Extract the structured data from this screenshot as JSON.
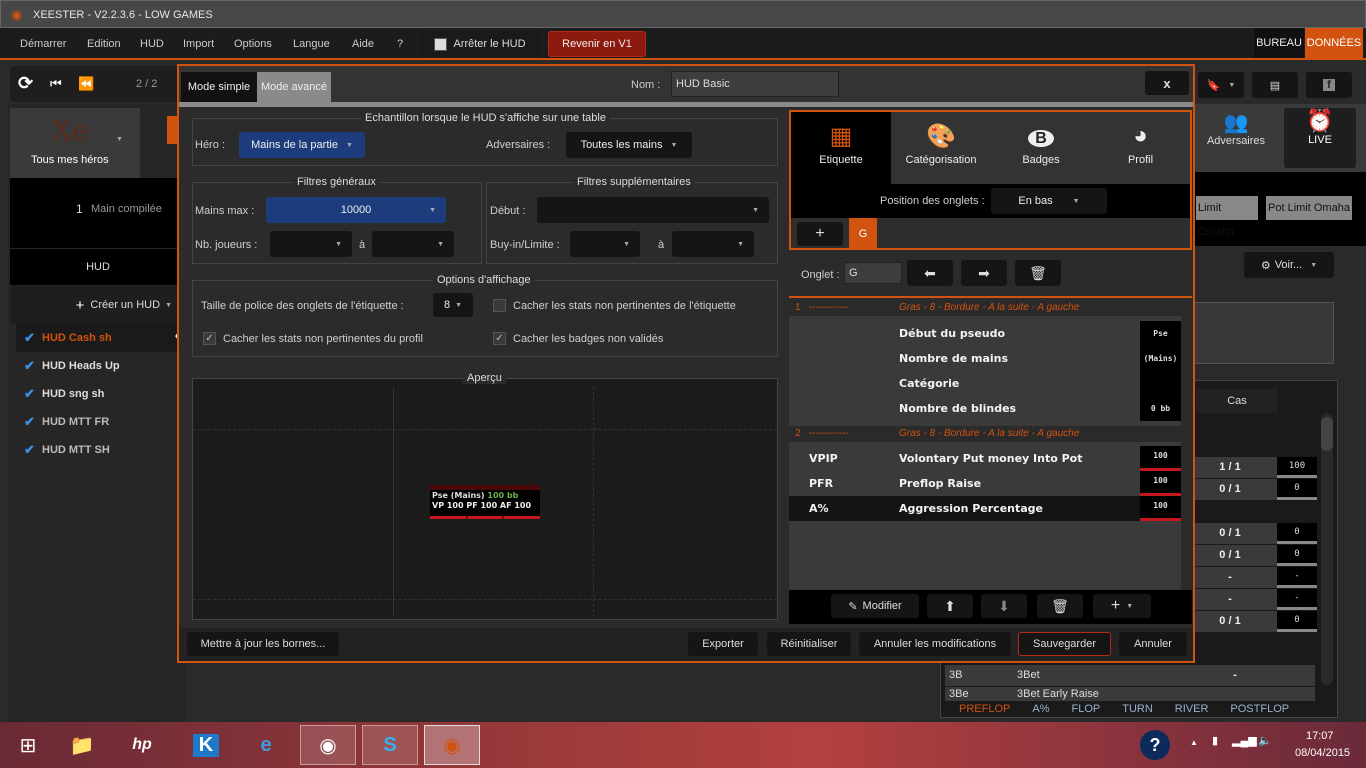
{
  "app": {
    "title": "XEESTER - V2.2.3.6 - LOW GAMES"
  },
  "menu": [
    "Démarrer",
    "Edition",
    "HUD",
    "Import",
    "Options",
    "Langue",
    "Aide",
    "?"
  ],
  "stop_hud": "Arrêter le HUD",
  "back_v1": "Revenir en V1",
  "bureau": "BUREAU",
  "donnees": "DONNÉES",
  "toolbar": {
    "page": "2 / 2"
  },
  "sidebar": {
    "heroes": "Tous mes héros",
    "hands_count": "1",
    "hands_label": "Main compilée",
    "hud_header": "HUD",
    "create": "Créer un HUD",
    "huds": [
      {
        "label": "HUD Cash sh",
        "active": true
      },
      {
        "label": "HUD Heads Up"
      },
      {
        "label": "HUD sng sh"
      },
      {
        "label": "HUD MTT FR"
      },
      {
        "label": "HUD MTT SH"
      }
    ]
  },
  "background": {
    "adversaires": "Adversaires",
    "live": "LIVE",
    "limit_omaha": "Limit Omaha",
    "pot_limit_omaha": "Pot Limit Omaha",
    "voir": "Voir...",
    "cas": "Cas",
    "table_rows": [
      [
        "1 / 1",
        "100"
      ],
      [
        "0 / 1",
        "0"
      ],
      [
        "0 / 1",
        "0"
      ],
      [
        "0 / 1",
        "0"
      ],
      [
        "-",
        "-"
      ],
      [
        "-",
        "-"
      ],
      [
        "0 / 1",
        "0"
      ],
      [
        "-",
        "-"
      ]
    ],
    "table_tail": [
      {
        "code": "3B",
        "name": "3Bet",
        "v": "-",
        "b": "-"
      },
      {
        "code": "3Be",
        "name": "3Bet Early Raise",
        "v": "-",
        "b": "-"
      }
    ],
    "street_tabs": [
      "PREFLOP",
      "A%",
      "FLOP",
      "TURN",
      "RIVER",
      "POSTFLOP"
    ]
  },
  "modal": {
    "mode_simple": "Mode simple",
    "mode_avance": "Mode avancé",
    "nom_label": "Nom :",
    "nom_value": "HUD Basic",
    "close": "x",
    "sample": {
      "title": "Echantillon lorsque le HUD s'affiche sur une table",
      "hero_label": "Héro :",
      "hero_value": "Mains de la partie",
      "adv_label": "Adversaires :",
      "adv_value": "Toutes les mains"
    },
    "general": {
      "title": "Filtres généraux",
      "mains_max_label": "Mains max :",
      "mains_max_value": "10000",
      "nb_joueurs_label": "Nb. joueurs :",
      "a": "à"
    },
    "extra": {
      "title": "Filtres supplémentaires",
      "debut_label": "Début :",
      "buyin_label": "Buy-in/Limite :",
      "a": "à"
    },
    "display": {
      "title": "Options d'affichage",
      "font_label": "Taille de police des onglets de l'étiquette :",
      "font_value": "8",
      "opt1": {
        "label": "Cacher les stats non pertinentes de l'étiquette",
        "checked": false
      },
      "opt2": {
        "label": "Cacher les stats non pertinentes du profil",
        "checked": true
      },
      "opt3": {
        "label": "Cacher les badges non validés",
        "checked": true
      }
    },
    "preview": {
      "title": "Aperçu",
      "line1a": "Pse (Mains)",
      "line1b": "100 bb",
      "line2": "VP 100 PF 100 AF 100"
    },
    "tabs": [
      "Etiquette",
      "Catégorisation",
      "Badges",
      "Profil"
    ],
    "position_label": "Position des onglets :",
    "position_value": "En bas",
    "tab_g": "G",
    "onglet_label": "Onglet :",
    "onglet_value": "G",
    "sections": [
      {
        "num": "1",
        "dash": "------------",
        "style": "Gras - 8 - Bordure - A la suite - A gauche",
        "rows": [
          {
            "code": "",
            "name": "Début du pseudo",
            "val": "Pse"
          },
          {
            "code": "",
            "name": "Nombre de mains",
            "val": "(Mains)"
          },
          {
            "code": "",
            "name": "Catégorie",
            "val": ""
          },
          {
            "code": "",
            "name": "Nombre de blindes",
            "val": "0 bb"
          }
        ]
      },
      {
        "num": "2",
        "dash": "------------",
        "style": "Gras - 8 - Bordure - A la suite - A gauche",
        "rows": [
          {
            "code": "VPIP",
            "name": "Volontary Put money Into Pot",
            "val": "100"
          },
          {
            "code": "PFR",
            "name": "Preflop Raise",
            "val": "100"
          },
          {
            "code": "A%",
            "name": "Aggression Percentage",
            "val": "100"
          }
        ]
      }
    ],
    "modifier": "Modifier",
    "footer": {
      "update": "Mettre à jour les bornes...",
      "export": "Exporter",
      "reset": "Réinitialiser",
      "cancel_mods": "Annuler les modifications",
      "save": "Sauvegarder",
      "cancel": "Annuler"
    }
  },
  "taskbar": {
    "time": "17:07",
    "date": "08/04/2015"
  },
  "colors": {
    "accent": "#d2520f",
    "blue": "#1d3c7c",
    "red": "#8d1a0f"
  }
}
